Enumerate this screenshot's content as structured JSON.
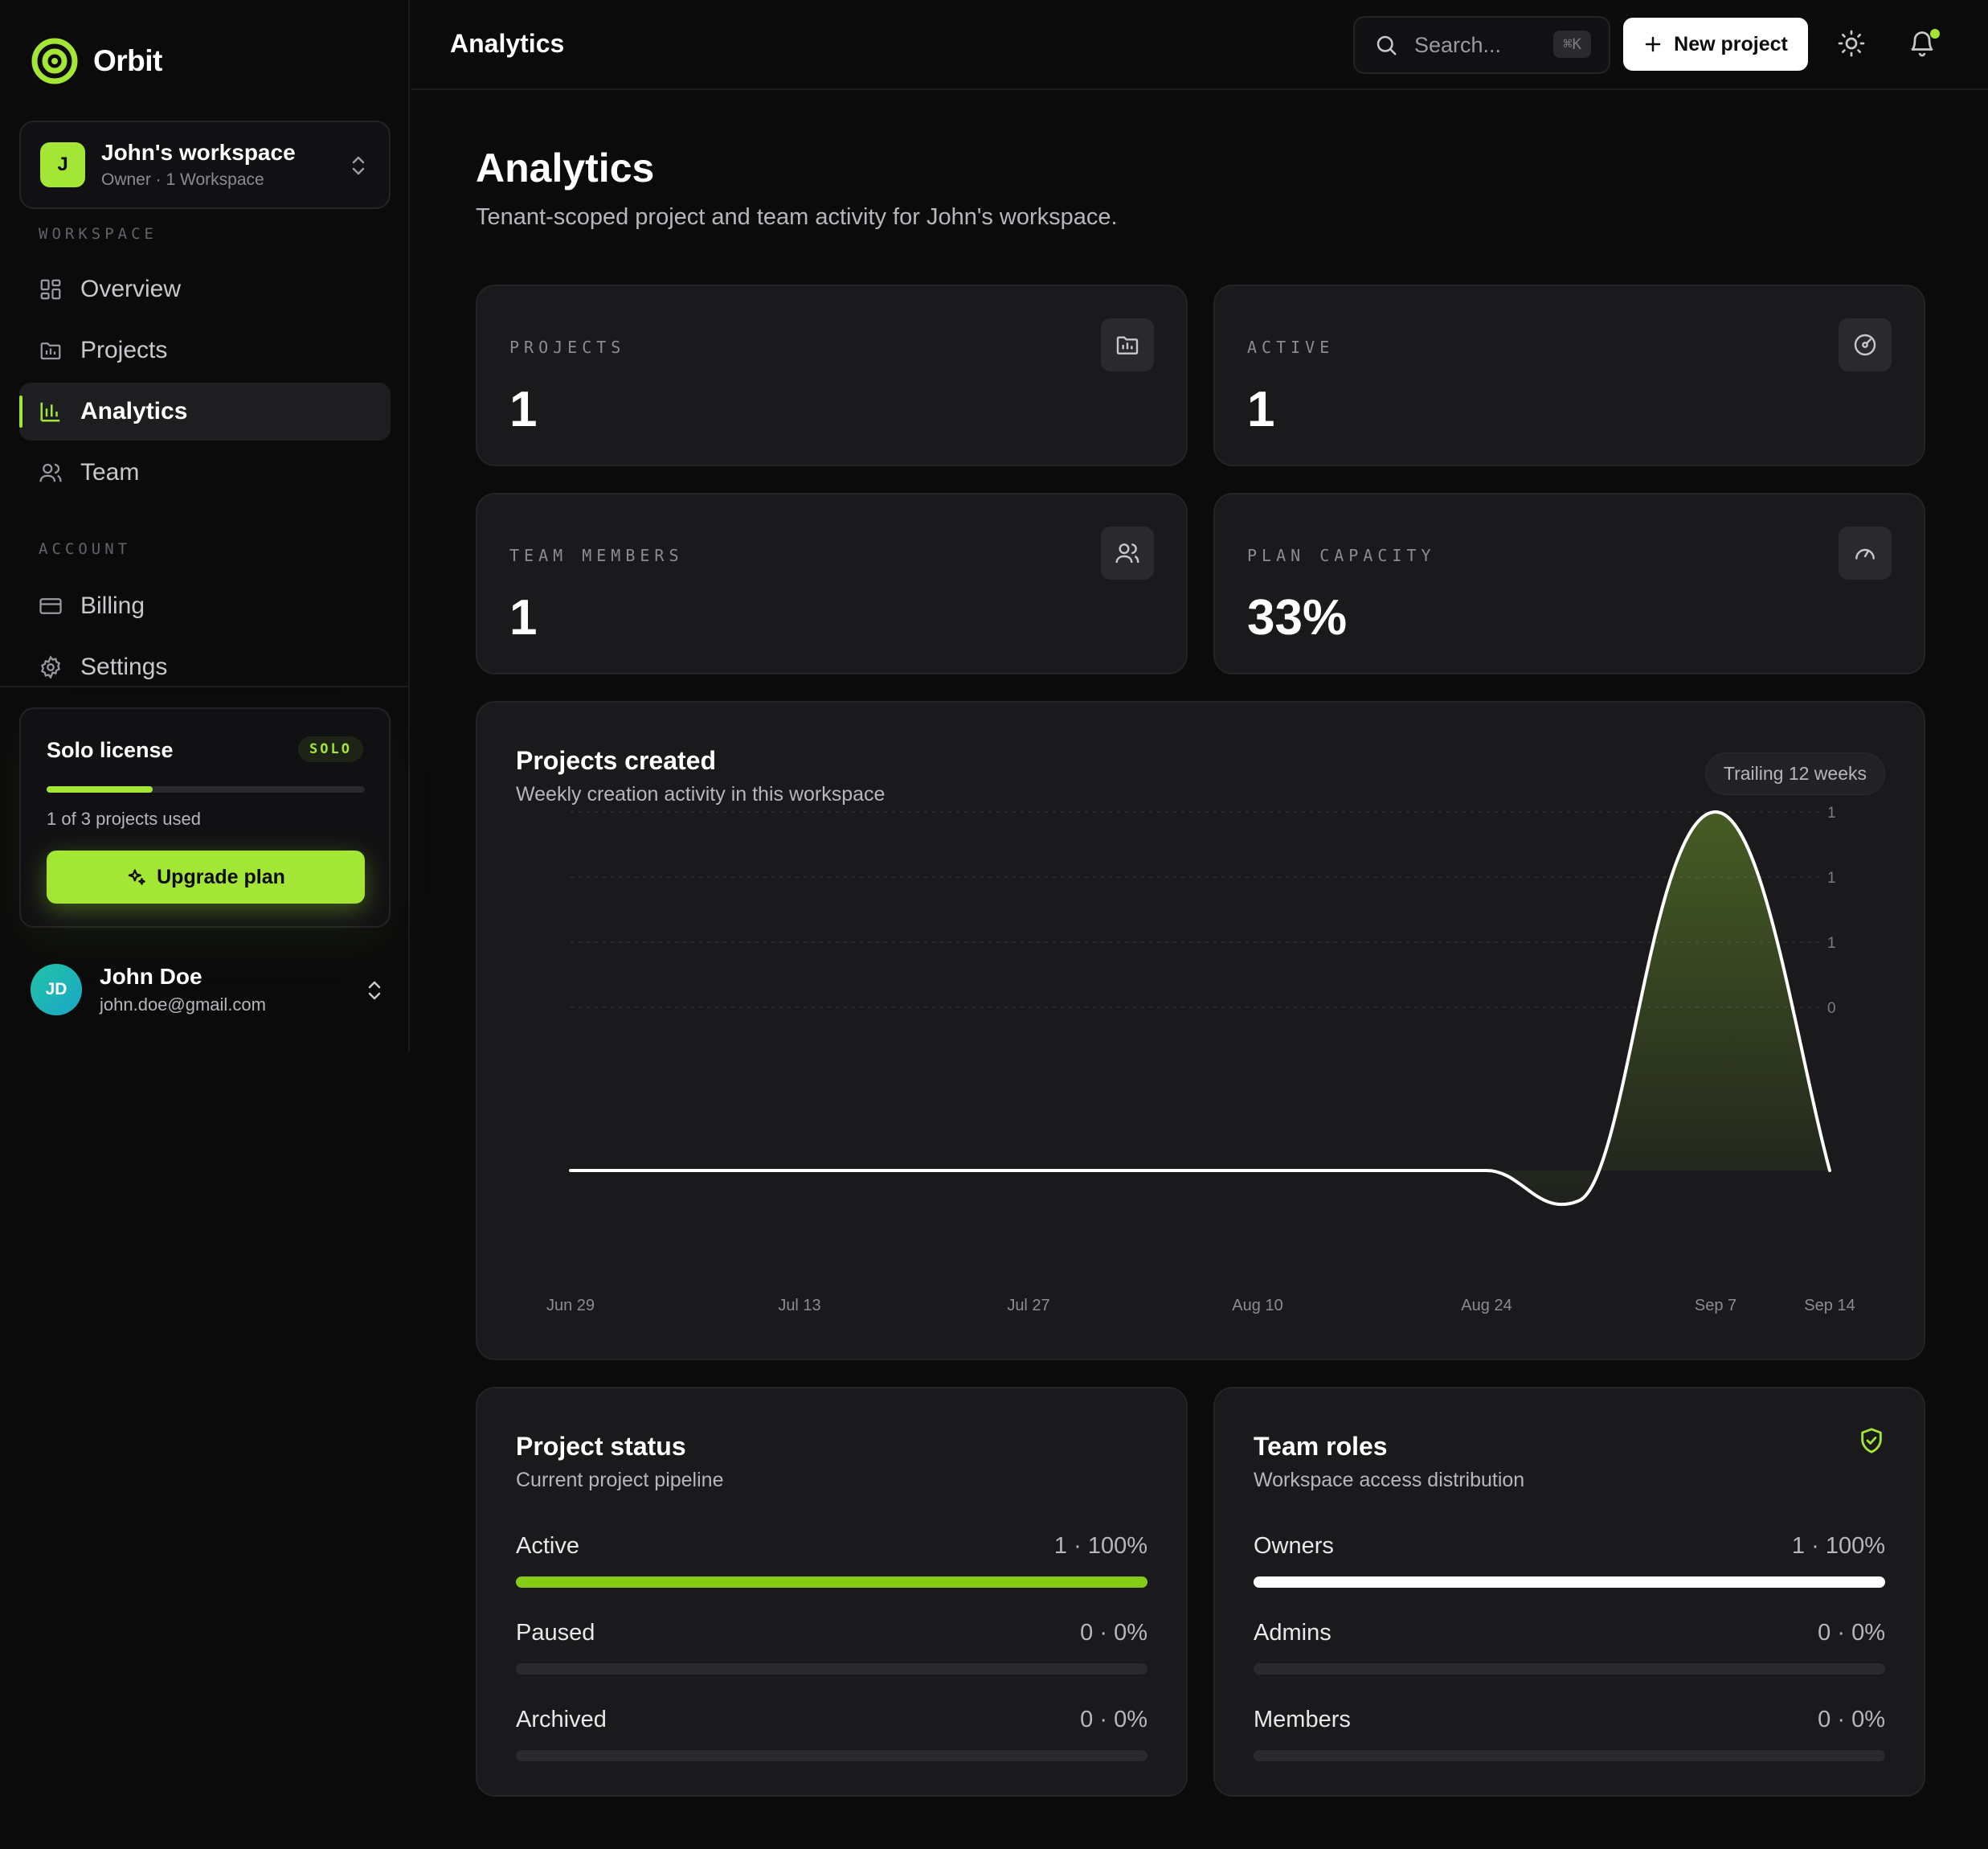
{
  "app": {
    "name": "Orbit",
    "brand_color": "#a3e635"
  },
  "workspace": {
    "initial": "J",
    "name": "John's workspace",
    "subtitle": "Owner · 1 Workspace"
  },
  "sidebar": {
    "workspace_section": "WORKSPACE",
    "account_section": "ACCOUNT",
    "items": [
      {
        "label": "Overview",
        "icon": "grid-icon"
      },
      {
        "label": "Projects",
        "icon": "folder-icon"
      },
      {
        "label": "Analytics",
        "icon": "bar-chart-icon",
        "active": true
      },
      {
        "label": "Team",
        "icon": "users-icon"
      },
      {
        "label": "Billing",
        "icon": "credit-card-icon"
      },
      {
        "label": "Settings",
        "icon": "gear-icon"
      }
    ]
  },
  "license": {
    "title": "Solo license",
    "badge": "SOLO",
    "used_text": "1 of 3 projects used",
    "used_fraction": 0.333,
    "upgrade_label": "Upgrade plan"
  },
  "user": {
    "initials": "JD",
    "name": "John Doe",
    "email": "john.doe@gmail.com"
  },
  "topbar": {
    "title": "Analytics",
    "search_placeholder": "Search...",
    "shortcut": "⌘K",
    "new_project_label": "New project"
  },
  "page": {
    "title": "Analytics",
    "subtitle": "Tenant-scoped project and team activity for John's workspace."
  },
  "stats": [
    {
      "label": "PROJECTS",
      "value": "1",
      "icon": "folder-chart-icon"
    },
    {
      "label": "ACTIVE",
      "value": "1",
      "icon": "target-icon"
    },
    {
      "label": "TEAM MEMBERS",
      "value": "1",
      "icon": "users-icon"
    },
    {
      "label": "PLAN CAPACITY",
      "value": "33%",
      "icon": "gauge-icon"
    }
  ],
  "chart": {
    "title": "Projects created",
    "subtitle": "Weekly creation activity in this workspace",
    "range_label": "Trailing 12 weeks"
  },
  "chart_data": {
    "type": "area",
    "x": [
      "Jun 29",
      "Jul 6",
      "Jul 13",
      "Jul 20",
      "Jul 27",
      "Aug 3",
      "Aug 10",
      "Aug 17",
      "Aug 24",
      "Aug 31",
      "Sep 7",
      "Sep 14"
    ],
    "x_tick_labels": [
      "Jun 29",
      "Jul 13",
      "Jul 27",
      "Aug 10",
      "Aug 24",
      "Sep 7",
      "Sep 14"
    ],
    "y_tick_labels": [
      "1",
      "1",
      "1",
      "0"
    ],
    "series": [
      {
        "values": [
          0,
          0,
          0,
          0,
          0,
          0,
          0,
          0,
          0,
          0,
          1,
          0
        ]
      }
    ],
    "ylim": [
      0,
      1
    ],
    "grid": true,
    "line_color": "#ffffff",
    "fill_color": "#a3e635"
  },
  "project_status": {
    "title": "Project status",
    "subtitle": "Current project pipeline",
    "rows": [
      {
        "label": "Active",
        "value": "1 · 100%",
        "fraction": 1.0,
        "color": "#84cc16"
      },
      {
        "label": "Paused",
        "value": "0 · 0%",
        "fraction": 0,
        "color": "#84cc16"
      },
      {
        "label": "Archived",
        "value": "0 · 0%",
        "fraction": 0,
        "color": "#84cc16"
      }
    ]
  },
  "team_roles": {
    "title": "Team roles",
    "subtitle": "Workspace access distribution",
    "rows": [
      {
        "label": "Owners",
        "value": "1 · 100%",
        "fraction": 1.0,
        "color": "#ffffff"
      },
      {
        "label": "Admins",
        "value": "0 · 0%",
        "fraction": 0,
        "color": "#ffffff"
      },
      {
        "label": "Members",
        "value": "0 · 0%",
        "fraction": 0,
        "color": "#ffffff"
      }
    ]
  }
}
